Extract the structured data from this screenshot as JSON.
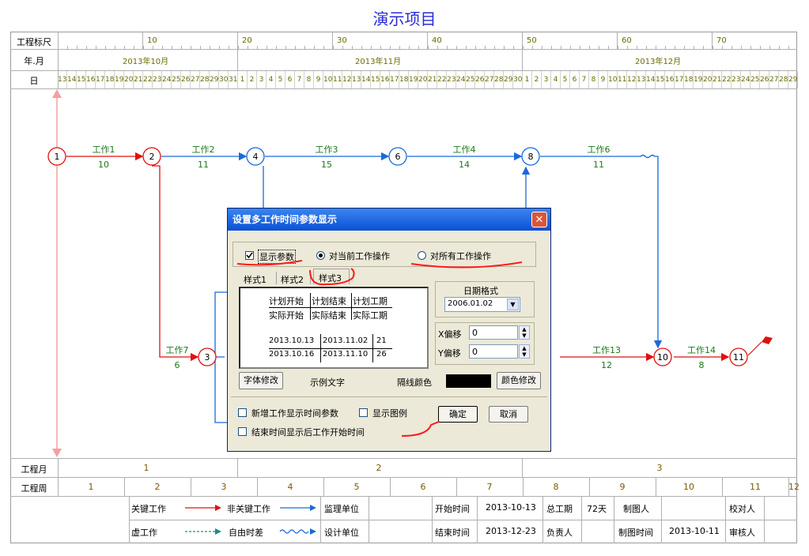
{
  "title": "演示项目",
  "header": {
    "scale_label": "工程标尺",
    "scale_marks": [
      "10",
      "20",
      "30",
      "40",
      "50",
      "60",
      "70"
    ],
    "month_label": "年.月",
    "months": [
      "2013年10月",
      "2013年11月",
      "2013年12月"
    ],
    "day_label": "日"
  },
  "days": [
    "13",
    "14",
    "15",
    "16",
    "17",
    "18",
    "19",
    "20",
    "21",
    "22",
    "23",
    "24",
    "25",
    "26",
    "27",
    "28",
    "29",
    "30",
    "31",
    "1",
    "2",
    "3",
    "4",
    "5",
    "6",
    "7",
    "8",
    "9",
    "10",
    "11",
    "12",
    "13",
    "14",
    "15",
    "16",
    "17",
    "18",
    "19",
    "20",
    "21",
    "22",
    "23",
    "24",
    "25",
    "26",
    "27",
    "28",
    "29",
    "30",
    "1",
    "2",
    "3",
    "4",
    "5",
    "6",
    "7",
    "8",
    "9",
    "10",
    "11",
    "12",
    "13",
    "14",
    "15",
    "16",
    "17",
    "18",
    "19",
    "20",
    "21",
    "22",
    "23",
    "24",
    "25",
    "26",
    "27",
    "28",
    "29"
  ],
  "network": {
    "nodes": [
      "1",
      "2",
      "3",
      "4",
      "6",
      "8",
      "10",
      "11"
    ],
    "tasks": [
      {
        "name": "工作1",
        "duration": "10"
      },
      {
        "name": "工作2",
        "duration": "11"
      },
      {
        "name": "工作3",
        "duration": "15"
      },
      {
        "name": "工作4",
        "duration": "14"
      },
      {
        "name": "工作6",
        "duration": "11"
      },
      {
        "name": "工作7",
        "duration": "6"
      },
      {
        "name": "工作13",
        "duration": "12"
      },
      {
        "name": "工作14",
        "duration": "8"
      }
    ]
  },
  "footer": {
    "month_label": "工程月",
    "month_nums": [
      "1",
      "2",
      "3"
    ],
    "week_label": "工程周",
    "week_nums": [
      "1",
      "2",
      "3",
      "4",
      "5",
      "6",
      "7",
      "8",
      "9",
      "10",
      "11",
      "12"
    ],
    "legend": {
      "critical": "关键工作",
      "noncritical": "非关键工作",
      "dummy": "虚工作",
      "float": "自由时差",
      "supervisor": "监理单位",
      "designer": "设计单位",
      "start_label": "开始时间",
      "start_value": "2013-10-13",
      "end_label": "结束时间",
      "end_value": "2013-12-23",
      "total_label": "总工期",
      "total_value": "72天",
      "owner_label": "负责人",
      "drawer_label": "制图人",
      "drawtime_label": "制图时间",
      "drawtime_value": "2013-10-11",
      "proof_label": "校对人",
      "review_label": "审核人"
    }
  },
  "dialog": {
    "title": "设置多工作时间参数显示",
    "show_params": "显示参数",
    "radio_current": "对当前工作操作",
    "radio_all": "对所有工作操作",
    "tabs": [
      "样式1",
      "样式2",
      "样式3"
    ],
    "preview": {
      "h1": "计划开始",
      "h2": "计划结束",
      "h3": "计划工期",
      "a1": "实际开始",
      "a2": "实际结束",
      "a3": "实际工期",
      "p1": "2013.10.13",
      "p2": "2013.11.02",
      "p3": "21",
      "r1": "2013.10.16",
      "r2": "2013.11.10",
      "r3": "26"
    },
    "date_format_label": "日期格式",
    "date_format_value": "2006.01.02",
    "x_offset_label": "X偏移",
    "x_offset_value": "0",
    "y_offset_label": "Y偏移",
    "y_offset_value": "0",
    "font_button": "字体修改",
    "sample_text": "示例文字",
    "line_color_label": "隔线颜色",
    "color_button": "颜色修改",
    "new_task_option": "新增工作显示时间参数",
    "show_legend_option": "显示图例",
    "end_time_option": "结束时间显示后工作开始时间",
    "ok_button": "确定",
    "cancel_button": "取消"
  },
  "colors": {
    "critical": "#e01010",
    "noncritical": "#1a6ad8",
    "label_green": "#1a7a1a",
    "axis_text": "#6b6b00",
    "dialog_bg": "#ece9d8",
    "title_blue": "#2a2ad8"
  }
}
